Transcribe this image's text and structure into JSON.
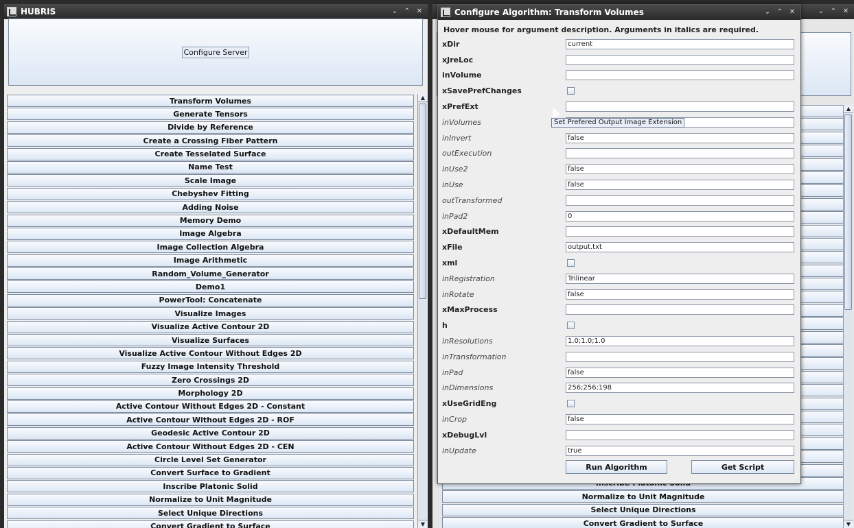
{
  "left_window": {
    "title": "HUBRIS",
    "configure_server": "Configure Server",
    "algorithms": [
      "Transform Volumes",
      "Generate Tensors",
      "Divide by Reference",
      "Create a Crossing Fiber Pattern",
      "Create Tesselated Surface",
      "Name Test",
      "Scale Image",
      "Chebyshev Fitting",
      "Adding Noise",
      "Memory Demo",
      "Image Algebra",
      "Image Collection Algebra",
      "Image Arithmetic",
      "Random_Volume_Generator",
      "Demo1",
      "PowerTool: Concatenate",
      "Visualize Images",
      "Visualize Active Contour 2D",
      "Visualize Surfaces",
      "Visualize Active Contour Without Edges 2D",
      "Fuzzy Image Intensity Threshold",
      "Zero Crossings 2D",
      "Morphology 2D",
      "Active Contour Without Edges 2D - Constant",
      "Active Contour Without Edges 2D - ROF",
      "Geodesic Active Contour 2D",
      "Active Contour Without Edges 2D - CEN",
      "Circle Level Set Generator",
      "Convert Surface to Gradient",
      "Inscribe Platonic Solid",
      "Normalize to Unit Magnitude",
      "Select Unique Directions",
      "Convert Gradient to Surface"
    ]
  },
  "right_back_window": {
    "visible_items": [
      "Inscribe Platonic Solid",
      "Normalize to Unit Magnitude",
      "Select Unique Directions",
      "Convert Gradient to Surface"
    ]
  },
  "dialog": {
    "title": "Configure Algorithm: Transform Volumes",
    "hint": "Hover mouse for argument description. Arguments in italics are required.",
    "tooltip": "Set Prefered Output Image Extension",
    "run_label": "Run Algorithm",
    "script_label": "Get Script",
    "params": [
      {
        "name": "xDir",
        "style": "bold",
        "kind": "text",
        "value": "current"
      },
      {
        "name": "xJreLoc",
        "style": "bold",
        "kind": "text",
        "value": ""
      },
      {
        "name": "inVolume",
        "style": "bold",
        "kind": "text",
        "value": ""
      },
      {
        "name": "xSavePrefChanges",
        "style": "bold",
        "kind": "check",
        "value": ""
      },
      {
        "name": "xPrefExt",
        "style": "bold",
        "kind": "text",
        "value": ""
      },
      {
        "name": "inVolumes",
        "style": "ital",
        "kind": "text",
        "value": ""
      },
      {
        "name": "inInvert",
        "style": "ital",
        "kind": "text",
        "value": "false"
      },
      {
        "name": "outExecution",
        "style": "ital",
        "kind": "text",
        "value": ""
      },
      {
        "name": "inUse2",
        "style": "ital",
        "kind": "text",
        "value": "false"
      },
      {
        "name": "inUse",
        "style": "ital",
        "kind": "text",
        "value": "false"
      },
      {
        "name": "outTransformed",
        "style": "ital",
        "kind": "text",
        "value": ""
      },
      {
        "name": "inPad2",
        "style": "ital",
        "kind": "text",
        "value": "0"
      },
      {
        "name": "xDefaultMem",
        "style": "bold",
        "kind": "text",
        "value": ""
      },
      {
        "name": "xFile",
        "style": "bold",
        "kind": "text",
        "value": "output.txt"
      },
      {
        "name": "xml",
        "style": "bold",
        "kind": "check",
        "value": ""
      },
      {
        "name": "inRegistration",
        "style": "ital",
        "kind": "text",
        "value": "Trilinear"
      },
      {
        "name": "inRotate",
        "style": "ital",
        "kind": "text",
        "value": "false"
      },
      {
        "name": "xMaxProcess",
        "style": "bold",
        "kind": "text",
        "value": ""
      },
      {
        "name": "h",
        "style": "bold",
        "kind": "check",
        "value": ""
      },
      {
        "name": "inResolutions",
        "style": "ital",
        "kind": "text",
        "value": "1.0;1.0;1.0"
      },
      {
        "name": "inTransformation",
        "style": "ital",
        "kind": "text",
        "value": ""
      },
      {
        "name": "inPad",
        "style": "ital",
        "kind": "text",
        "value": "false"
      },
      {
        "name": "inDimensions",
        "style": "ital",
        "kind": "text",
        "value": "256;256;198"
      },
      {
        "name": "xUseGridEng",
        "style": "bold",
        "kind": "check",
        "value": ""
      },
      {
        "name": "inCrop",
        "style": "ital",
        "kind": "text",
        "value": "false"
      },
      {
        "name": "xDebugLvl",
        "style": "bold",
        "kind": "text",
        "value": ""
      },
      {
        "name": "inUpdate",
        "style": "ital",
        "kind": "text",
        "value": "true"
      }
    ]
  }
}
